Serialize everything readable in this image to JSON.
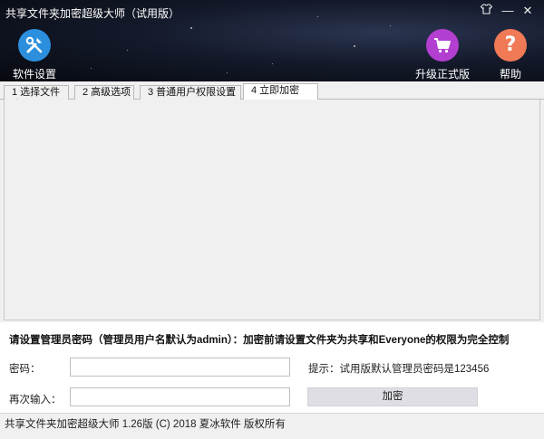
{
  "window": {
    "title": "共享文件夹加密超级大师（试用版）",
    "controls": {
      "skin_icon": "shirt-icon",
      "minimize": "—",
      "close": "✕"
    }
  },
  "toolbar": {
    "settings_label": "软件设置",
    "upgrade_label": "升级正式版",
    "help_label": "帮助",
    "help_glyph": "?",
    "colors": {
      "settings": "#2b8fde",
      "upgrade": "#b23fd0",
      "help": "#f07a55"
    }
  },
  "tabs": [
    {
      "label": "1 选择文件夹",
      "active": false
    },
    {
      "label": "2 高级选项",
      "active": false
    },
    {
      "label": "3 普通用户权限设置",
      "active": false
    },
    {
      "label": "4 立即加密",
      "active": true
    }
  ],
  "form": {
    "instruction": "请设置管理员密码（管理员用户名默认为admin）：加密前请设置文件夹为共享和Everyone的权限为完全控制",
    "password_label": "密码：",
    "password_value": "",
    "confirm_label": "再次输入：",
    "confirm_value": "",
    "hint": "提示：试用版默认管理员密码是123456",
    "encrypt_button": "加密"
  },
  "status_bar": "共享文件夹加密超级大师 1.26版 (C) 2018 夏冰软件 版权所有"
}
